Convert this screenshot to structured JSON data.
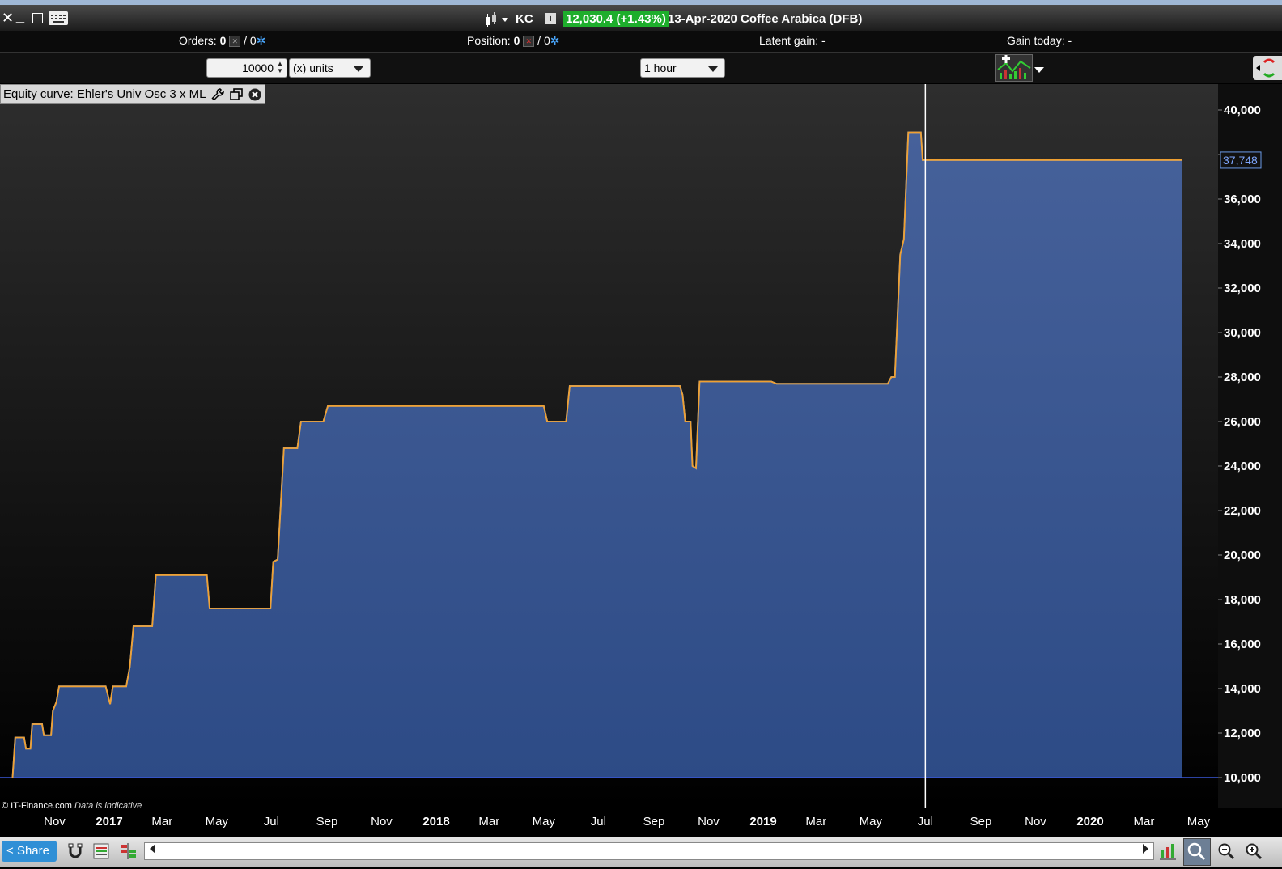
{
  "window": {
    "symbol": "KC",
    "price_badge": "12,030.4 (+1.43%)",
    "title": "13-Apr-2020 Coffee Arabica (DFB)",
    "info_label": "i"
  },
  "status": {
    "orders_label": "Orders:",
    "orders_count": "0",
    "orders_sep": "/ 0",
    "position_label": "Position:",
    "position_count": "0",
    "position_sep": "/ 0",
    "latent_label": "Latent gain: -",
    "gain_today_label": "Gain today: -"
  },
  "toolbar": {
    "units_value": "10000",
    "units_select": "(x) units",
    "timeframe": "1 hour"
  },
  "chart_panel": {
    "title": "Equity curve: Ehler's Univ Osc 3 x ML",
    "watermark": "© IT-Finance.com",
    "watermark_note": "Data is indicative",
    "current_value_label": "37,748"
  },
  "bottombar": {
    "share_label": "Share"
  },
  "colors": {
    "line": "#f0a030",
    "fill_top": "#46619a",
    "fill_bottom": "#2d4b86",
    "baseline": "#3a58d8",
    "crosshair": "#ffffff",
    "price_badge": "#1eae2c"
  },
  "chart_data": {
    "type": "area",
    "title": "Equity curve: Ehler's Univ Osc 3 x ML",
    "xlabel": "",
    "ylabel": "",
    "ylim": [
      9000,
      40800
    ],
    "xlim": [
      "2016-09-15",
      "2020-06-15"
    ],
    "yticks": [
      "10,000",
      "12,000",
      "14,000",
      "16,000",
      "18,000",
      "20,000",
      "22,000",
      "24,000",
      "26,000",
      "28,000",
      "30,000",
      "32,000",
      "34,000",
      "36,000",
      "38,000",
      "40,000"
    ],
    "ytick_values": [
      10000,
      12000,
      14000,
      16000,
      18000,
      20000,
      22000,
      24000,
      26000,
      28000,
      30000,
      32000,
      34000,
      36000,
      38000,
      40000
    ],
    "xticks": [
      {
        "label": "Nov",
        "date": "2016-11-01",
        "bold": false
      },
      {
        "label": "2017",
        "date": "2017-01-01",
        "bold": true
      },
      {
        "label": "Mar",
        "date": "2017-03-01",
        "bold": false
      },
      {
        "label": "May",
        "date": "2017-05-01",
        "bold": false
      },
      {
        "label": "Jul",
        "date": "2017-07-01",
        "bold": false
      },
      {
        "label": "Sep",
        "date": "2017-09-01",
        "bold": false
      },
      {
        "label": "Nov",
        "date": "2017-11-01",
        "bold": false
      },
      {
        "label": "2018",
        "date": "2018-01-01",
        "bold": true
      },
      {
        "label": "Mar",
        "date": "2018-03-01",
        "bold": false
      },
      {
        "label": "May",
        "date": "2018-05-01",
        "bold": false
      },
      {
        "label": "Jul",
        "date": "2018-07-01",
        "bold": false
      },
      {
        "label": "Sep",
        "date": "2018-09-01",
        "bold": false
      },
      {
        "label": "Nov",
        "date": "2018-11-01",
        "bold": false
      },
      {
        "label": "2019",
        "date": "2019-01-01",
        "bold": true
      },
      {
        "label": "Mar",
        "date": "2019-03-01",
        "bold": false
      },
      {
        "label": "May",
        "date": "2019-05-01",
        "bold": false
      },
      {
        "label": "Jul",
        "date": "2019-07-01",
        "bold": false
      },
      {
        "label": "Sep",
        "date": "2019-09-01",
        "bold": false
      },
      {
        "label": "Nov",
        "date": "2019-11-01",
        "bold": false
      },
      {
        "label": "2020",
        "date": "2020-01-01",
        "bold": true
      },
      {
        "label": "Mar",
        "date": "2020-03-01",
        "bold": false
      },
      {
        "label": "May",
        "date": "2020-05-01",
        "bold": false
      }
    ],
    "crosshair_date": "2019-07-01",
    "current_value": 37748,
    "series": [
      {
        "values": [
          [
            "2016-09-15",
            10000
          ],
          [
            "2016-09-18",
            11800
          ],
          [
            "2016-09-28",
            11800
          ],
          [
            "2016-09-30",
            11300
          ],
          [
            "2016-10-05",
            11300
          ],
          [
            "2016-10-07",
            12400
          ],
          [
            "2016-10-18",
            12400
          ],
          [
            "2016-10-20",
            11900
          ],
          [
            "2016-10-28",
            11900
          ],
          [
            "2016-10-30",
            13000
          ],
          [
            "2016-11-03",
            13400
          ],
          [
            "2016-11-06",
            14100
          ],
          [
            "2016-12-28",
            14100
          ],
          [
            "2017-01-02",
            13300
          ],
          [
            "2017-01-05",
            14100
          ],
          [
            "2017-01-20",
            14100
          ],
          [
            "2017-01-24",
            15000
          ],
          [
            "2017-01-28",
            16800
          ],
          [
            "2017-02-18",
            16800
          ],
          [
            "2017-02-22",
            19100
          ],
          [
            "2017-04-20",
            19100
          ],
          [
            "2017-04-23",
            17600
          ],
          [
            "2017-06-30",
            17600
          ],
          [
            "2017-07-03",
            19700
          ],
          [
            "2017-07-08",
            19800
          ],
          [
            "2017-07-15",
            24800
          ],
          [
            "2017-07-30",
            24800
          ],
          [
            "2017-08-03",
            26000
          ],
          [
            "2017-08-28",
            26000
          ],
          [
            "2017-09-02",
            26700
          ],
          [
            "2018-05-01",
            26700
          ],
          [
            "2018-05-05",
            26000
          ],
          [
            "2018-05-26",
            26000
          ],
          [
            "2018-05-30",
            27600
          ],
          [
            "2018-09-30",
            27600
          ],
          [
            "2018-10-03",
            27200
          ],
          [
            "2018-10-06",
            26000
          ],
          [
            "2018-10-12",
            26000
          ],
          [
            "2018-10-14",
            24000
          ],
          [
            "2018-10-18",
            23900
          ],
          [
            "2018-10-22",
            27800
          ],
          [
            "2019-01-10",
            27800
          ],
          [
            "2019-01-16",
            27700
          ],
          [
            "2019-05-20",
            27700
          ],
          [
            "2019-05-24",
            28000
          ],
          [
            "2019-05-28",
            28000
          ],
          [
            "2019-06-03",
            33500
          ],
          [
            "2019-06-07",
            34200
          ],
          [
            "2019-06-12",
            39000
          ],
          [
            "2019-06-26",
            39000
          ],
          [
            "2019-06-28",
            37748
          ],
          [
            "2020-04-13",
            37748
          ]
        ]
      }
    ]
  }
}
